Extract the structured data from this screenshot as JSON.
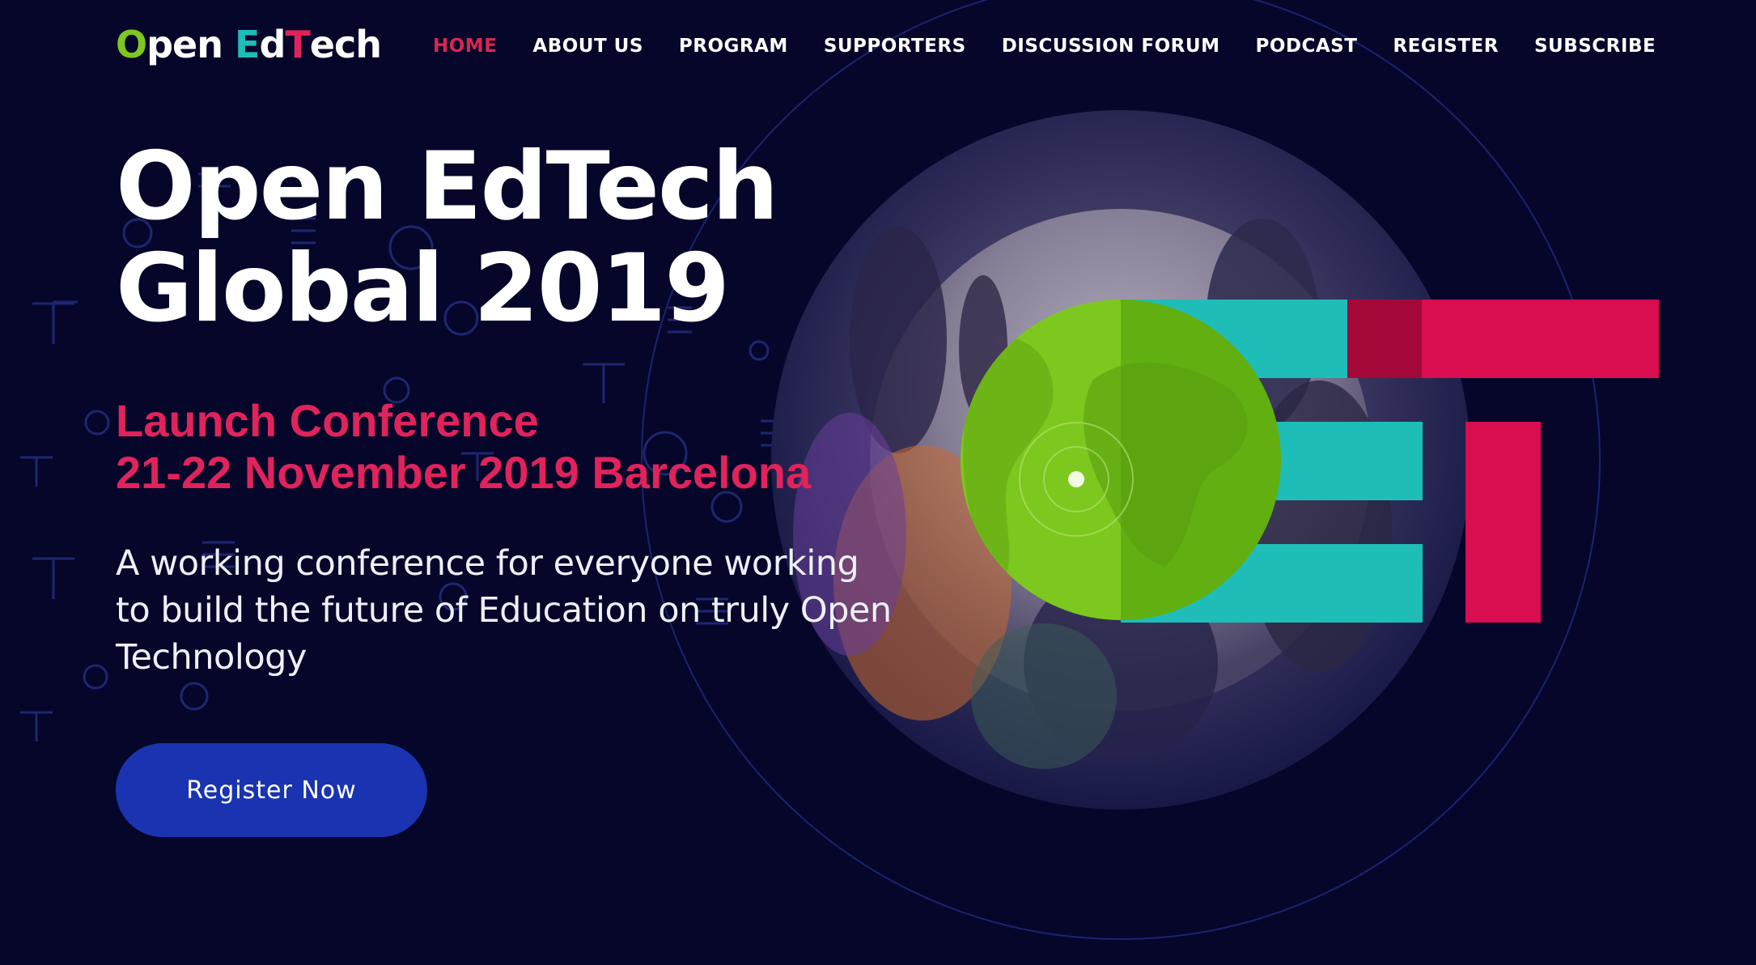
{
  "colors": {
    "background": "#05062a",
    "accent_pink": "#e0235b",
    "accent_green": "#7dc81e",
    "accent_teal": "#1fbdb8",
    "button_blue": "#1a33b0"
  },
  "logo": {
    "letters": [
      "O",
      "pen ",
      "E",
      "d",
      "T",
      "ech"
    ],
    "letter_colors": [
      "#7dc81e",
      "#ffffff",
      "#1fbdb8",
      "#ffffff",
      "#e0235b",
      "#ffffff"
    ]
  },
  "nav": {
    "items": [
      {
        "label": "HOME",
        "active": true
      },
      {
        "label": "ABOUT US",
        "active": false
      },
      {
        "label": "PROGRAM",
        "active": false
      },
      {
        "label": "SUPPORTERS",
        "active": false
      },
      {
        "label": "DISCUSSION FORUM",
        "active": false
      },
      {
        "label": "PODCAST",
        "active": false
      },
      {
        "label": "REGISTER",
        "active": false
      },
      {
        "label": "SUBSCRIBE",
        "active": false
      }
    ]
  },
  "hero": {
    "title_line1": "Open EdTech",
    "title_line2": "Global 2019",
    "subtitle_line1": "Launch Conference",
    "subtitle_line2": "21-22 November 2019 Barcelona",
    "description": "A working conference for everyone working to build the future of Education on truly Open Technology",
    "cta_label": "Register Now"
  },
  "graphic": {
    "icons": [
      "globe-icon",
      "e-letter-bars",
      "t-letter-bars"
    ]
  }
}
